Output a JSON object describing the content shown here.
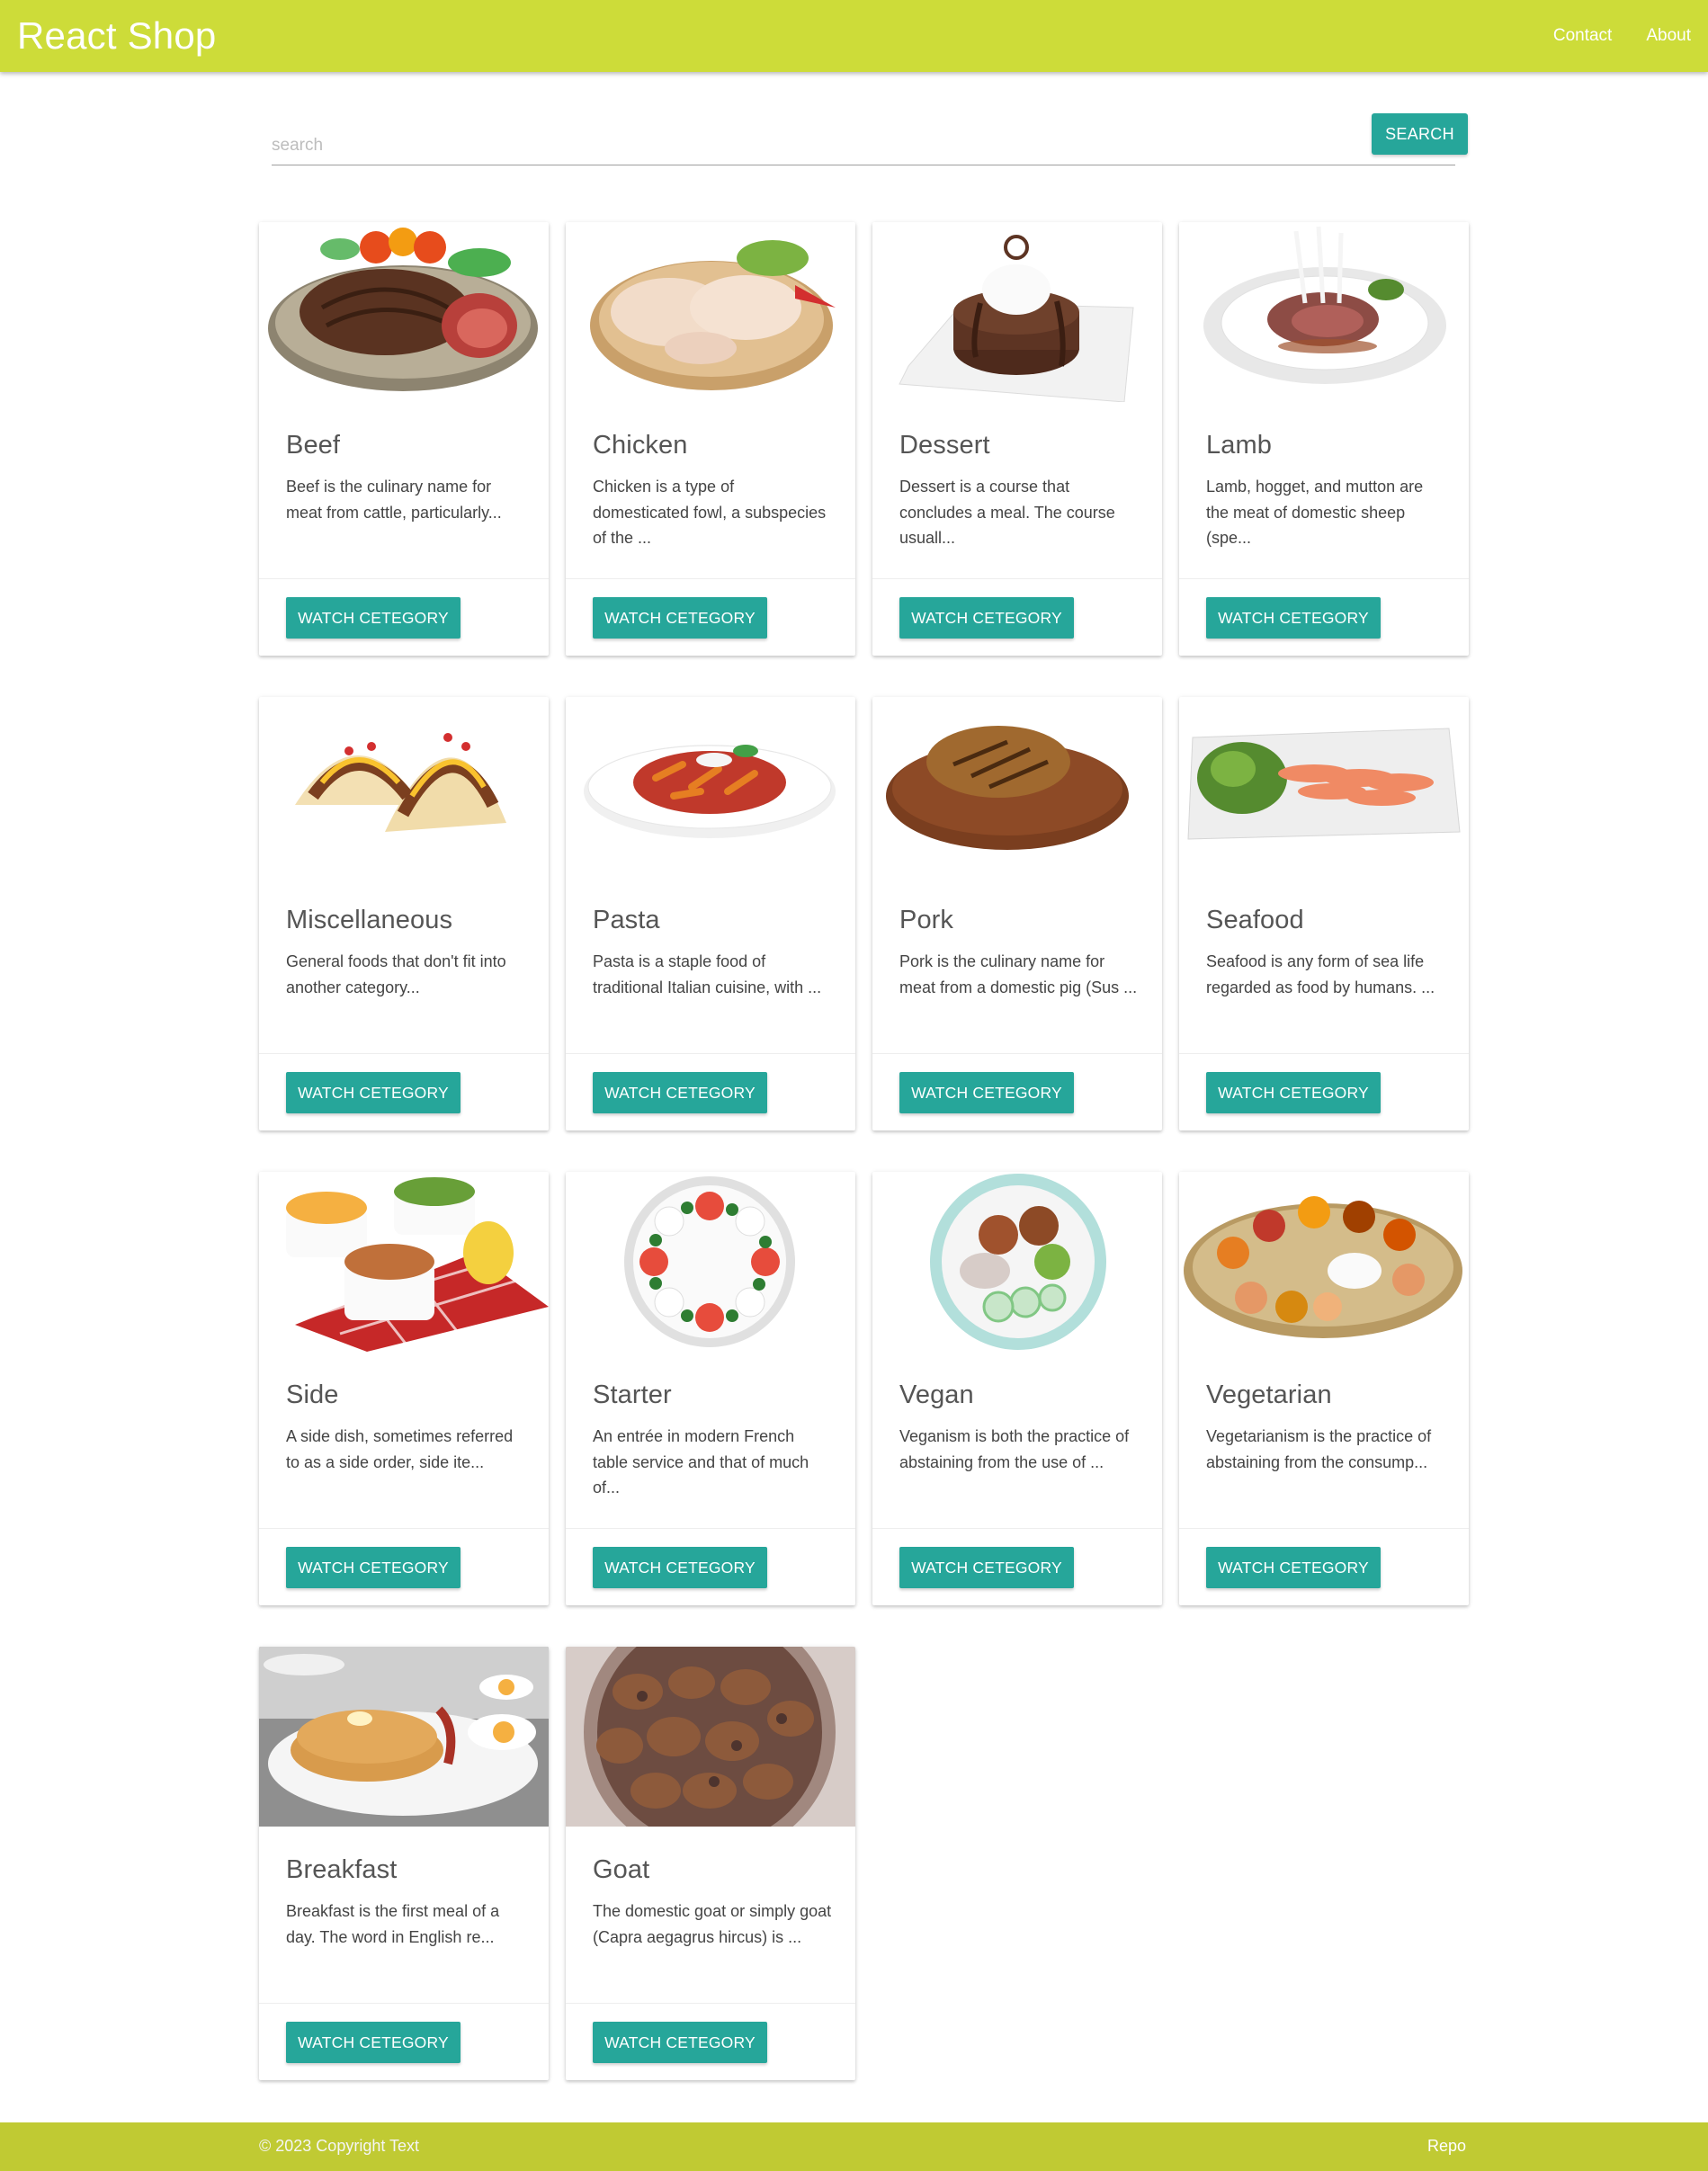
{
  "header": {
    "brand": "React Shop",
    "links": [
      "Contact",
      "About"
    ]
  },
  "search": {
    "placeholder": "search",
    "value": "",
    "button_label": "SEARCH"
  },
  "categories": [
    {
      "name": "Beef",
      "description": "Beef is the culinary name for meat from cattle, particularly...",
      "button": "WATCH CETEGORY",
      "image": "steak-image"
    },
    {
      "name": "Chicken",
      "description": "Chicken is a type of domesticated fowl, a subspecies of the ...",
      "button": "WATCH CETEGORY",
      "image": "chicken-image"
    },
    {
      "name": "Dessert",
      "description": "Dessert is a course that concludes a meal. The course usuall...",
      "button": "WATCH CETEGORY",
      "image": "dessert-image"
    },
    {
      "name": "Lamb",
      "description": "Lamb, hogget, and mutton are the meat of domestic sheep (spe...",
      "button": "WATCH CETEGORY",
      "image": "lamb-image"
    },
    {
      "name": "Miscellaneous",
      "description": "General foods that don't fit into another category...",
      "button": "WATCH CETEGORY",
      "image": "tacos-image"
    },
    {
      "name": "Pasta",
      "description": "Pasta is a staple food of traditional Italian cuisine, with ...",
      "button": "WATCH CETEGORY",
      "image": "pasta-image"
    },
    {
      "name": "Pork",
      "description": "Pork is the culinary name for meat from a domestic pig (Sus ...",
      "button": "WATCH CETEGORY",
      "image": "pork-image"
    },
    {
      "name": "Seafood",
      "description": "Seafood is any form of sea life regarded as food by humans. ...",
      "button": "WATCH CETEGORY",
      "image": "seafood-image"
    },
    {
      "name": "Side",
      "description": "A side dish, sometimes referred to as a side order, side ite...",
      "button": "WATCH CETEGORY",
      "image": "side-dishes-image"
    },
    {
      "name": "Starter",
      "description": "An entrée in modern French table service and that of much of...",
      "button": "WATCH CETEGORY",
      "image": "caprese-image"
    },
    {
      "name": "Vegan",
      "description": "Veganism is both the practice of abstaining from the use of ...",
      "button": "WATCH CETEGORY",
      "image": "vegan-bowl-image"
    },
    {
      "name": "Vegetarian",
      "description": "Vegetarianism is the practice of abstaining from the consump...",
      "button": "WATCH CETEGORY",
      "image": "thali-image"
    },
    {
      "name": "Breakfast",
      "description": "Breakfast is the first meal of a day. The word in English re...",
      "button": "WATCH CETEGORY",
      "image": "pancakes-image"
    },
    {
      "name": "Goat",
      "description": "The domestic goat or simply goat (Capra aegagrus hircus) is ...",
      "button": "WATCH CETEGORY",
      "image": "goat-meat-image"
    }
  ],
  "footer": {
    "copyright": "© 2023 Copyright Text",
    "repo_link": "Repo"
  },
  "colors": {
    "navbar": "#cddc39",
    "footer": "#c0ca33",
    "accent": "#26a69a"
  }
}
